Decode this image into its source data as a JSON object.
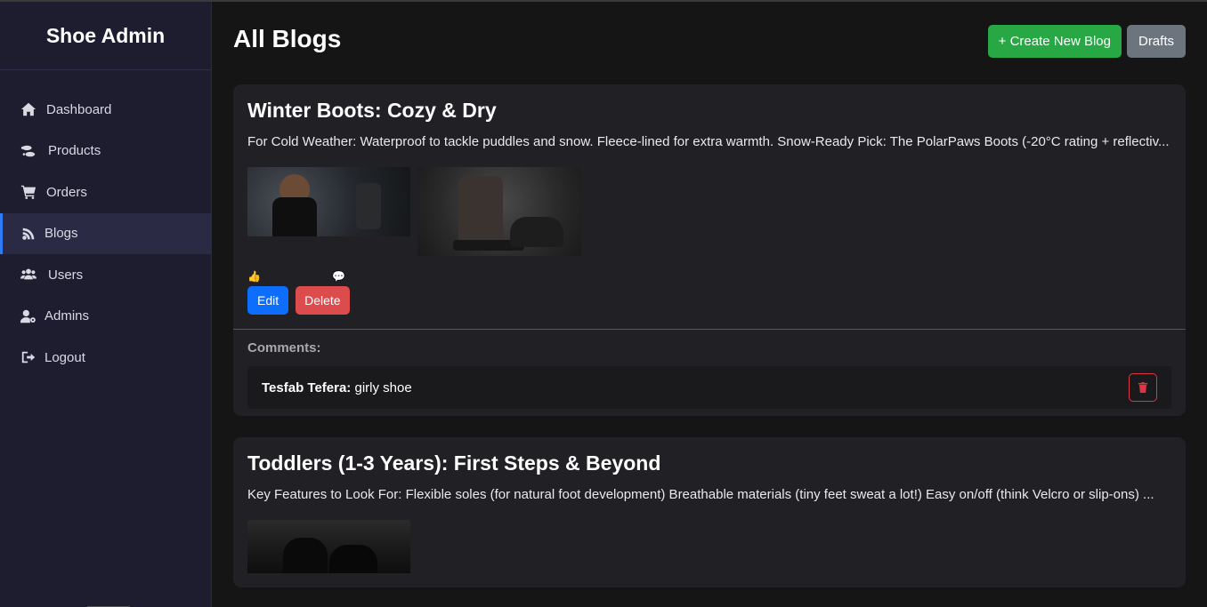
{
  "sidebar": {
    "brand": "Shoe Admin",
    "items": [
      {
        "label": "Dashboard",
        "icon": "home-icon"
      },
      {
        "label": "Products",
        "icon": "shoe-prints-icon"
      },
      {
        "label": "Orders",
        "icon": "cart-icon"
      },
      {
        "label": "Blogs",
        "icon": "blog-icon",
        "active": true
      },
      {
        "label": "Users",
        "icon": "users-icon"
      },
      {
        "label": "Admins",
        "icon": "user-gear-icon"
      },
      {
        "label": "Logout",
        "icon": "logout-icon"
      }
    ]
  },
  "header": {
    "title": "All Blogs",
    "create_label": "+ Create New Blog",
    "drafts_label": "Drafts"
  },
  "posts": [
    {
      "title": "Winter Boots: Cozy & Dry",
      "excerpt": "For Cold Weather: Waterproof to tackle puddles and snow. Fleece-lined for extra warmth. Snow-Ready Pick: The PolarPaws Boots (-20°C rating + reflectiv...",
      "like_icon": "👍",
      "comment_icon": "💬",
      "edit_label": "Edit",
      "delete_label": "Delete",
      "comments_title": "Comments:",
      "comments": [
        {
          "author": "Tesfab Tefera:",
          "text": "girly shoe"
        }
      ]
    },
    {
      "title": "Toddlers (1-3 Years): First Steps & Beyond",
      "excerpt": "Key Features to Look For: Flexible soles (for natural foot development) Breathable materials (tiny feet sweat a lot!) Easy on/off (think Velcro or slip-ons) ..."
    }
  ],
  "colors": {
    "sidebar_bg": "#1e1d30",
    "active_accent": "#2f7bf5",
    "create_green": "#28a745",
    "drafts_gray": "#6c757d",
    "edit_blue": "#0d6efd",
    "delete_red": "#dc4c4c"
  }
}
